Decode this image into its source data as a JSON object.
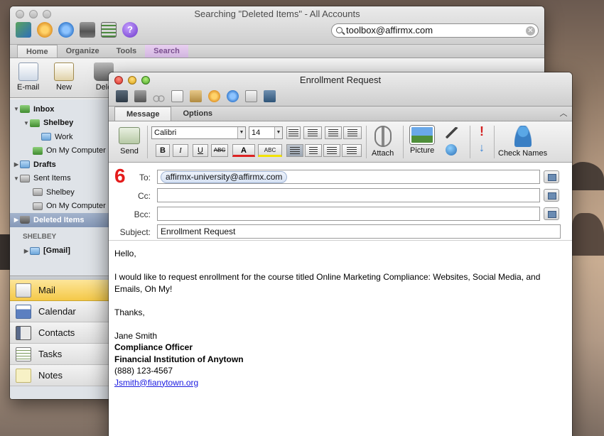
{
  "main_window": {
    "title": "Searching \"Deleted Items\" - All Accounts",
    "search_value": "toolbox@affirmx.com",
    "tabs": [
      "Home",
      "Organize",
      "Tools",
      "Search"
    ],
    "ribbon": {
      "email_label": "E-mail",
      "new_label": "New",
      "delete_label": "Dele"
    },
    "folders": {
      "inbox": "Inbox",
      "shelbey": "Shelbey",
      "work": "Work",
      "on_my_computer_1": "On My Computer",
      "drafts": "Drafts",
      "sent_items": "Sent Items",
      "sent_shelbey": "Shelbey",
      "on_my_computer_2": "On My Computer",
      "deleted_items": "Deleted Items",
      "section_shelbey": "SHELBEY",
      "gmail": "[Gmail]"
    },
    "nav": [
      "Mail",
      "Calendar",
      "Contacts",
      "Tasks",
      "Notes"
    ]
  },
  "compose": {
    "title": "Enrollment Request",
    "tabs": [
      "Message",
      "Options"
    ],
    "ribbon": {
      "send_label": "Send",
      "font": "Calibri",
      "size": "14",
      "bold": "B",
      "italic": "I",
      "underline": "U",
      "strike": "ABC",
      "color": "A",
      "highlight": "ABC",
      "attach_label": "Attach",
      "picture_label": "Picture",
      "check_names_label": "Check Names"
    },
    "step_number": "6",
    "to_label": "To:",
    "to_value": "affirmx-university@affirmx.com",
    "cc_label": "Cc:",
    "cc_value": "",
    "bcc_label": "Bcc:",
    "bcc_value": "",
    "subject_label": "Subject:",
    "subject_value": "Enrollment Request",
    "body": {
      "greeting": "Hello,",
      "paragraph": "I would like to request enrollment for the course titled Online Marketing Compliance: Websites, Social Media, and Emails, Oh My!",
      "closing": "Thanks,",
      "name": "Jane Smith",
      "job_title": "Compliance Officer",
      "company": "Financial Institution of Anytown",
      "phone": "(888) 123-4567",
      "email": "Jsmith@fianytown.org"
    }
  },
  "colors": {
    "step_number": "#e41b1b",
    "selected_folder": "#8699b9",
    "active_nav": "#f4c948",
    "link": "#1a1ae0"
  }
}
